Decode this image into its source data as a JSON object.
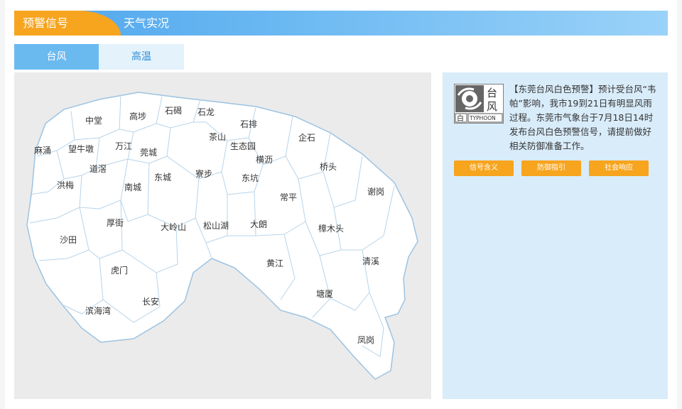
{
  "nav": {
    "active_tab": "预警信号",
    "inactive_tab": "天气实况"
  },
  "subtabs": {
    "active": "台风",
    "inactive": "高温"
  },
  "map": {
    "towns": [
      "中堂",
      "高埗",
      "石碣",
      "石龙",
      "石排",
      "茶山",
      "企石",
      "麻涌",
      "望牛墩",
      "万江",
      "莞城",
      "生态园",
      "横沥",
      "道滘",
      "东城",
      "寮步",
      "东坑",
      "桥头",
      "洪梅",
      "南城",
      "常平",
      "谢岗",
      "厚街",
      "大岭山",
      "松山湖",
      "大朗",
      "樟木头",
      "沙田",
      "虎门",
      "黄江",
      "清溪",
      "长安",
      "塘厦",
      "滨海湾",
      "凤岗"
    ],
    "fill_color": "#ffffff",
    "border_color": "#9cc3e2",
    "background_color": "#ebebeb"
  },
  "warning": {
    "icon": {
      "name": "typhoon-icon",
      "big_char_top": "台",
      "big_char_bottom": "风",
      "level_char": "白",
      "english": "TYPHOON"
    },
    "text": "【东莞台风白色预警】预计受台风“韦帕”影响，我市19到21日有明显风雨过程。东莞市气象台于7月18日14时发布台风白色预警信号，请提前做好相关防御准备工作。",
    "buttons": [
      "信号含义",
      "防御指引",
      "社会响应"
    ]
  },
  "colors": {
    "accent": "#f7a41e",
    "primary": "#4fa6ec",
    "panel_bg": "#d9ecfa"
  }
}
